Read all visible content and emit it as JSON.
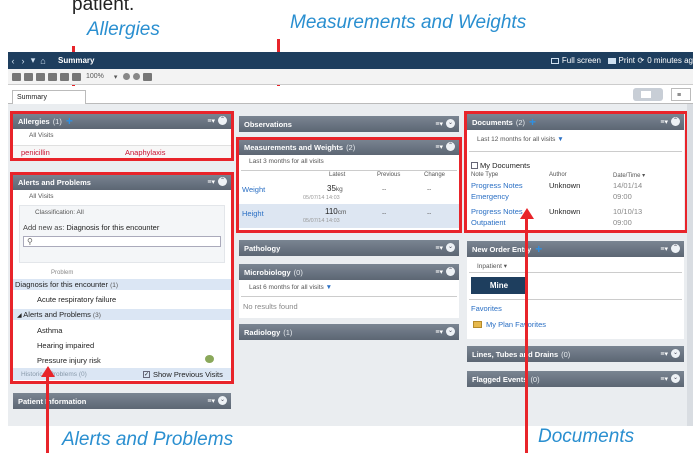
{
  "callouts": {
    "top_fragment": "patient.",
    "allergies": "Allergies",
    "measurements": "Measurements and Weights",
    "alerts": "Alerts and Problems",
    "documents": "Documents"
  },
  "window": {
    "title": "Summary",
    "full_screen": "Full screen",
    "print": "Print",
    "refresh": "0 minutes ag",
    "zoom": "100%",
    "tab": "Summary"
  },
  "allergies": {
    "title": "Allergies",
    "count": "(1)",
    "filter": "All Visits",
    "row": {
      "name": "penicillin",
      "reaction": "Anaphylaxis"
    }
  },
  "alerts": {
    "title": "Alerts and Problems",
    "filter": "All Visits",
    "classification_label": "Classification: All",
    "add_new_label": "Add new as:",
    "add_new_value": "Diagnosis for this encounter",
    "col_problem": "Problem",
    "group1": "Diagnosis for this encounter",
    "group1_count": "(1)",
    "group1_items": [
      "Acute respiratory failure"
    ],
    "group2": "Alerts and Problems",
    "group2_count": "(3)",
    "group2_items": [
      "Asthma",
      "Hearing impaired",
      "Pressure injury risk"
    ],
    "historical": "Historical Problems",
    "historical_count": "(0)",
    "show_previous": "Show Previous Visits"
  },
  "patient_info": {
    "title": "Patient Information"
  },
  "observations": {
    "title": "Observations"
  },
  "measurements": {
    "title": "Measurements and Weights",
    "count": "(2)",
    "filter": "Last 3 months for all visits",
    "cols": [
      "Latest",
      "Previous",
      "Change"
    ],
    "rows": [
      {
        "name": "Weight",
        "value": "35",
        "unit": "kg",
        "date": "05/07/14 14:03",
        "previous": "--",
        "change": "--"
      },
      {
        "name": "Height",
        "value": "110",
        "unit": "cm",
        "date": "05/07/14 14:03",
        "previous": "--",
        "change": "--"
      }
    ]
  },
  "pathology": {
    "title": "Pathology"
  },
  "microbiology": {
    "title": "Microbiology",
    "count": "(0)",
    "filter": "Last 6 months for all visits",
    "empty": "No results found"
  },
  "radiology": {
    "title": "Radiology",
    "count": "(1)"
  },
  "documents": {
    "title": "Documents",
    "count": "(2)",
    "filter": "Last 12 months for all visits",
    "my_docs": "My Documents",
    "cols": [
      "Note Type",
      "Author",
      "Date/Time"
    ],
    "rows": [
      {
        "type": "Progress Notes",
        "sub": "Emergency",
        "author": "Unknown",
        "date": "14/01/14",
        "time": "09:00"
      },
      {
        "type": "Progress Notes",
        "sub": "Outpatient",
        "author": "Unknown",
        "date": "10/10/13",
        "time": "09:00"
      }
    ]
  },
  "new_order": {
    "title": "New Order Entry",
    "selector": "Inpatient",
    "mine": "Mine",
    "favorites": "Favorites",
    "my_plan": "My Plan Favorites"
  },
  "lines": {
    "title": "Lines, Tubes and Drains",
    "count": "(0)"
  },
  "flagged": {
    "title": "Flagged Events",
    "count": "(0)"
  },
  "colors": {
    "accent": "#2a8fd0",
    "highlight": "#e8242a",
    "header": "#5c6673",
    "titlebar": "#1e3e5e"
  }
}
